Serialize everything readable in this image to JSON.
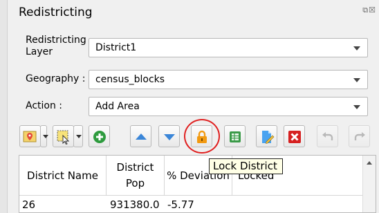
{
  "panel": {
    "title": "Redistricting",
    "window_buttons": "⧉☒"
  },
  "form": {
    "layer_label_1": "Redistricting",
    "layer_label_2": "Layer",
    "layer_value": "District1",
    "geography_label": "Geography :",
    "geography_value": "census_blocks",
    "action_label": "Action :",
    "action_value": "Add Area"
  },
  "toolbar": {
    "buttons": [
      {
        "name": "map-pin-icon",
        "enabled": true
      },
      {
        "name": "select-features-icon",
        "enabled": true
      },
      {
        "name": "add-icon",
        "enabled": true,
        "color": "#2e9b3e"
      },
      {
        "name": "up-arrow-icon",
        "enabled": true,
        "color": "#3b86d8"
      },
      {
        "name": "down-arrow-icon",
        "enabled": true,
        "color": "#3b86d8"
      },
      {
        "name": "lock-icon",
        "enabled": true,
        "color": "#f29a11"
      },
      {
        "name": "table-icon",
        "enabled": true,
        "color": "#3a9a48"
      },
      {
        "name": "edit-document-icon",
        "enabled": true,
        "color": "#3b86d8"
      },
      {
        "name": "delete-icon",
        "enabled": true,
        "color": "#d62020"
      },
      {
        "name": "undo-icon",
        "enabled": false
      },
      {
        "name": "redo-icon",
        "enabled": false
      }
    ],
    "tooltip": "Lock District",
    "highlight_color": "#e02020"
  },
  "table": {
    "headers": {
      "district_name": "District Name",
      "district_pop_1": "District",
      "district_pop_2": "Pop",
      "deviation": "% Deviation",
      "locked": "Locked"
    },
    "rows": [
      {
        "district_name": "26",
        "district_pop": "931380.0",
        "deviation": "-5.77",
        "locked": ""
      }
    ]
  }
}
